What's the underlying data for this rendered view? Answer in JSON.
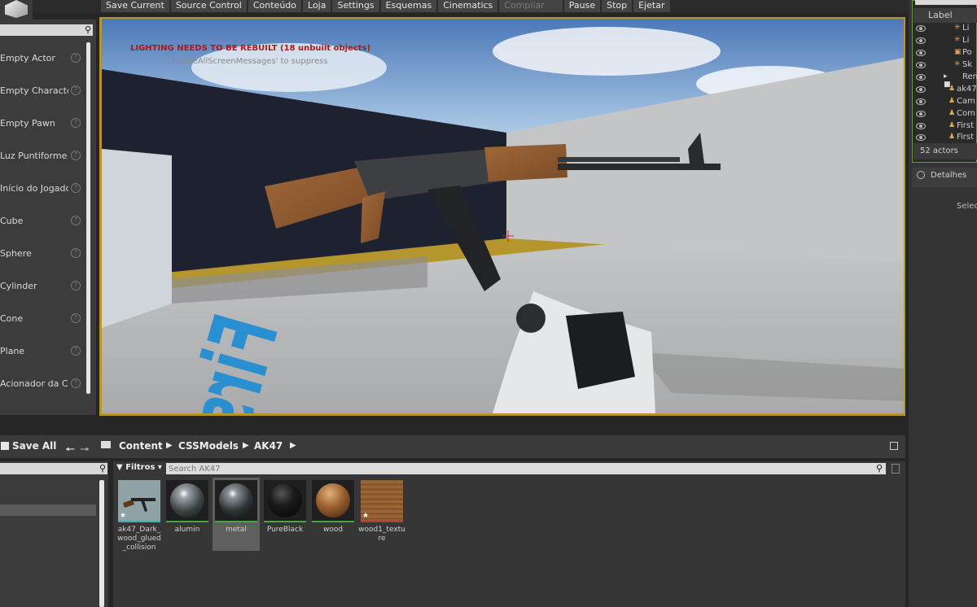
{
  "toolbar": {
    "save_current": "Save Current",
    "source_control": "Source Control",
    "conteudo": "Conteúdo",
    "loja": "Loja",
    "settings": "Settings",
    "esquemas": "Esquemas",
    "cinematics": "Cinematics",
    "compilar": "Compilar",
    "pause": "Pause",
    "stop": "Stop",
    "ejetar": "Ejetar"
  },
  "place_panel": {
    "items": [
      {
        "label": "Empty Actor"
      },
      {
        "label": "Empty Character"
      },
      {
        "label": "Empty Pawn"
      },
      {
        "label": "Luz Puntiforme"
      },
      {
        "label": "Início do Jogador"
      },
      {
        "label": "Cube"
      },
      {
        "label": "Sphere"
      },
      {
        "label": "Cylinder"
      },
      {
        "label": "Cone"
      },
      {
        "label": "Plane"
      },
      {
        "label": "Acionador da Cai"
      }
    ],
    "help_glyph": "?"
  },
  "viewport": {
    "lighting_message": "LIGHTING NEEDS TO BE REBUILT (18 unbuilt objects)",
    "lighting_sub": "'DisableAllScreenMessages' to suppress",
    "floor_text": "First"
  },
  "outliner": {
    "column_label": "Label",
    "rows": [
      {
        "label": "Li"
      },
      {
        "label": "Li"
      },
      {
        "label": "Po"
      },
      {
        "label": "Sk"
      },
      {
        "label": "Rend"
      },
      {
        "label": "ak47"
      },
      {
        "label": "Cam"
      },
      {
        "label": "Com"
      },
      {
        "label": "First"
      },
      {
        "label": "First"
      }
    ],
    "actors_count": "52 actors"
  },
  "details": {
    "tab_label": "Detalhes",
    "select_hint": "Selec"
  },
  "content_browser": {
    "save_all": "Save All",
    "breadcrumb": [
      "Content",
      "CSSModels",
      "AK47"
    ],
    "filters_label": "Filtros",
    "search_placeholder": "Search AK47",
    "assets": [
      {
        "name": "ak47_Dark_wood_glued_collision",
        "type_color": "#3fb3a8",
        "selected": false
      },
      {
        "name": "alumin",
        "type_color": "#4aa54a",
        "selected": false
      },
      {
        "name": "metal",
        "type_color": "#4aa54a",
        "selected": true
      },
      {
        "name": "PureBlack",
        "type_color": "#4aa54a",
        "selected": false
      },
      {
        "name": "wood",
        "type_color": "#4aa54a",
        "selected": false
      },
      {
        "name": "wood1_texture",
        "type_color": "#b23a3a",
        "selected": false
      }
    ]
  },
  "colors": {
    "viewport_border": "#b5962c",
    "outliner_border": "#6a9a3e",
    "lighting_warning": "#b0161a"
  }
}
